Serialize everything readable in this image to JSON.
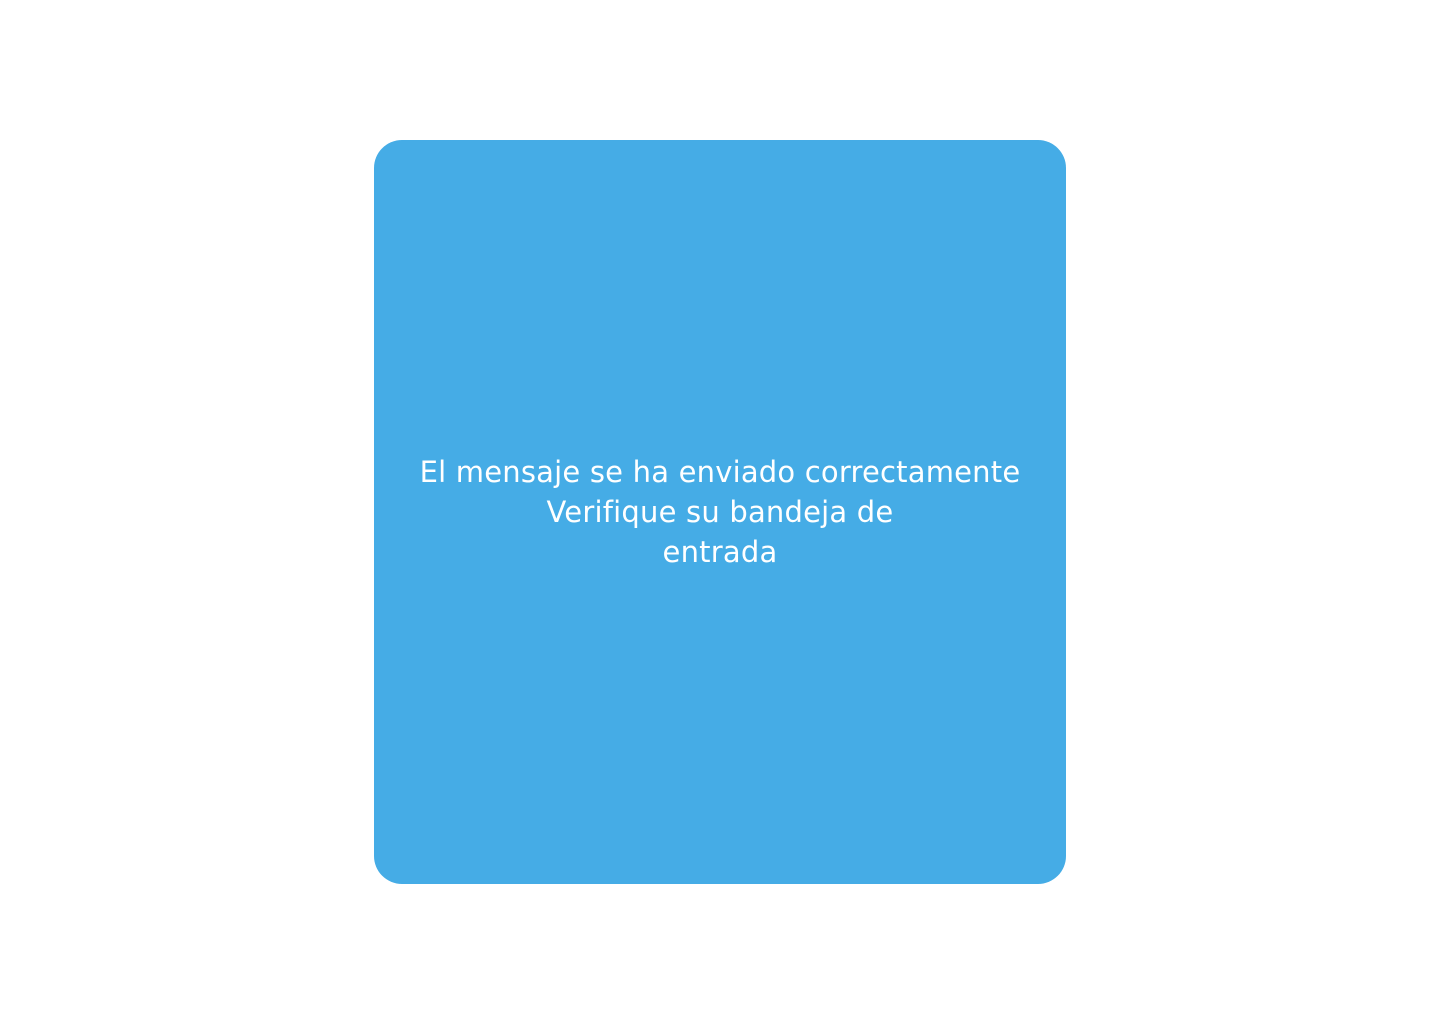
{
  "colors": {
    "background": "#ffffff",
    "card": "#45ace6",
    "text": "#ffffff"
  },
  "notification": {
    "lines": [
      "El mensaje se ha enviado correctamente",
      "Verifique su bandeja de",
      "entrada"
    ]
  }
}
